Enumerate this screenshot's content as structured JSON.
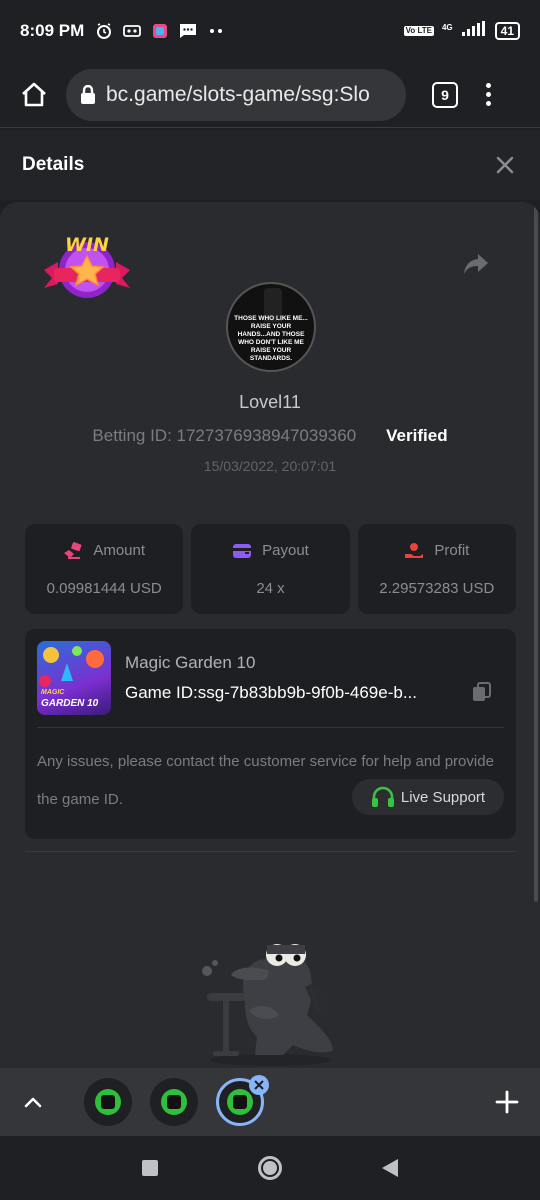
{
  "status_bar": {
    "time": "8:09 PM",
    "battery": "41",
    "network": "4G",
    "volte": "Vo LTE"
  },
  "browser": {
    "url": "bc.game/slots-game/ssg:Slo",
    "tab_count": "9"
  },
  "details": {
    "title": "Details"
  },
  "profile": {
    "win_badge": "WIN",
    "avatar_caption": "THOSE WHO LIKE ME... RAISE YOUR HANDS...AND THOSE WHO DON'T LIKE ME RAISE YOUR STANDARDS.",
    "username": "Lovel11",
    "betting_id": "Betting ID: 1727376938947039360",
    "verified": "Verified",
    "timestamp": "15/03/2022, 20:07:01"
  },
  "stats": [
    {
      "label": "Amount",
      "value": "0.09981444 USD",
      "icon": "amount-icon",
      "color": "#e8457a"
    },
    {
      "label": "Payout",
      "value": "24 x",
      "icon": "wallet-icon",
      "color": "#8b5cf6"
    },
    {
      "label": "Profit",
      "value": "2.29573283 USD",
      "icon": "profit-icon",
      "color": "#e8423a"
    }
  ],
  "game": {
    "thumb_title_small": "MAGIC",
    "thumb_title": "GARDEN 10",
    "name": "Magic Garden 10",
    "game_id": "Game ID:ssg-7b83bb9b-9f0b-469e-b...",
    "issue_text": "Any issues, please contact the customer service for help and provide the game ID.",
    "live_support": "Live Support"
  },
  "colors": {
    "accent_green": "#3ac244",
    "active_tab": "#8ab4f8"
  }
}
